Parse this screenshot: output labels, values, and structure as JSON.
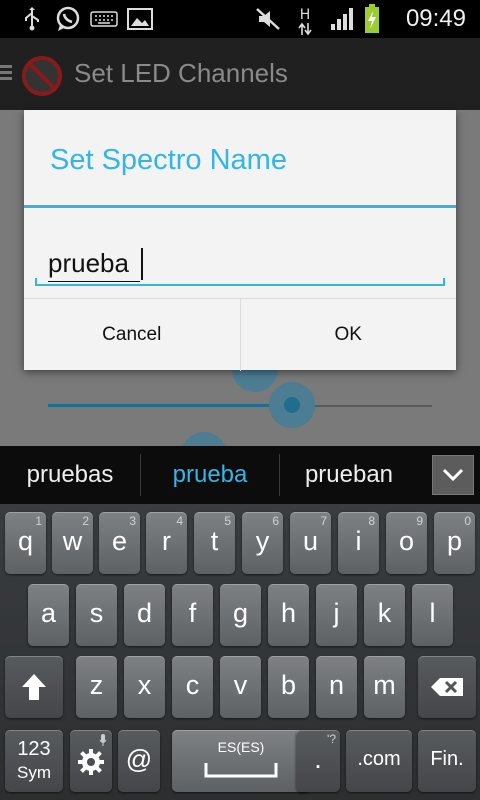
{
  "status_bar": {
    "time": "09:49",
    "network_label": "H",
    "icons": [
      "usb-icon",
      "whatsapp-icon",
      "keyboard-icon",
      "image-icon",
      "mute-icon",
      "data-arrows-icon",
      "signal-icon",
      "battery-charging-icon"
    ]
  },
  "app": {
    "title": "Set LED Channels"
  },
  "dialog": {
    "title": "Set Spectro Name",
    "input_value": "prueba",
    "cancel_label": "Cancel",
    "ok_label": "OK"
  },
  "suggestions": {
    "items": [
      "pruebas",
      "prueba",
      "prueban"
    ],
    "selected_index": 1
  },
  "keyboard": {
    "row1": [
      {
        "ch": "q",
        "sub": "1"
      },
      {
        "ch": "w",
        "sub": "2"
      },
      {
        "ch": "e",
        "sub": "3"
      },
      {
        "ch": "r",
        "sub": "4"
      },
      {
        "ch": "t",
        "sub": "5"
      },
      {
        "ch": "y",
        "sub": "6"
      },
      {
        "ch": "u",
        "sub": "7"
      },
      {
        "ch": "i",
        "sub": "8"
      },
      {
        "ch": "o",
        "sub": "9"
      },
      {
        "ch": "p",
        "sub": "0"
      }
    ],
    "row2": [
      "a",
      "s",
      "d",
      "f",
      "g",
      "h",
      "j",
      "k",
      "l"
    ],
    "row3": [
      "z",
      "x",
      "c",
      "v",
      "b",
      "n",
      "m"
    ],
    "sym_label_top": "123",
    "sym_label_bottom": "Sym",
    "at_label": "@",
    "space_lang": "ES(ES)",
    "period_label": ".",
    "period_sub": "'?",
    "dotcom_label": ".com",
    "fin_label": "Fin."
  },
  "colors": {
    "accent": "#33b5e5",
    "dialog_bg": "#f3f3f3",
    "key_bg": "#6e7174"
  }
}
